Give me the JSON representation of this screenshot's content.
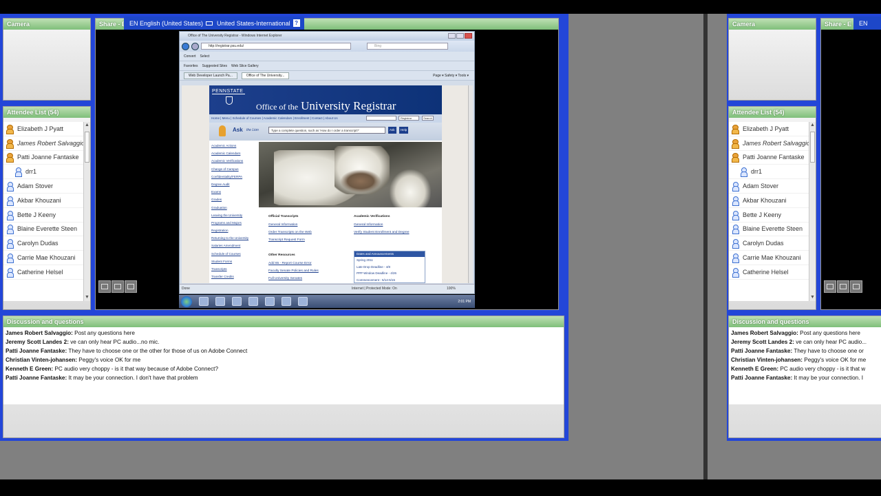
{
  "left_view": {
    "camera": {
      "title": "Camera"
    },
    "share": {
      "title": "Share - E"
    },
    "language_bar": {
      "input_language": "EN English (United States)",
      "keyboard_layout": "United States-International",
      "help_symbol": "?"
    },
    "attendees": {
      "title": "Attendee List (54)",
      "items": [
        {
          "name": "Elizabeth J Pyatt",
          "role": "host",
          "italic": false,
          "indent": false
        },
        {
          "name": "James Robert Salvaggio",
          "role": "host",
          "italic": true,
          "indent": false
        },
        {
          "name": "Patti Joanne Fantaske",
          "role": "host",
          "italic": false,
          "indent": false
        },
        {
          "name": "drr1",
          "role": "participant",
          "italic": false,
          "indent": true
        },
        {
          "name": "Adam Stover",
          "role": "participant",
          "italic": false,
          "indent": false
        },
        {
          "name": "Akbar Khouzani",
          "role": "participant",
          "italic": false,
          "indent": false
        },
        {
          "name": "Bette J Keeny",
          "role": "participant",
          "italic": false,
          "indent": false
        },
        {
          "name": "Blaine Everette Steen",
          "role": "participant",
          "italic": false,
          "indent": false
        },
        {
          "name": "Carolyn Dudas",
          "role": "participant",
          "italic": false,
          "indent": false
        },
        {
          "name": "Carrie Mae Khouzani",
          "role": "participant",
          "italic": false,
          "indent": false
        },
        {
          "name": "Catherine Helsel",
          "role": "participant",
          "italic": false,
          "indent": false
        }
      ]
    },
    "discussion": {
      "title": "Discussion and questions",
      "messages": [
        {
          "author": "James Robert Salvaggio:",
          "text": " Post any questions here"
        },
        {
          "author": "Jeremy Scott Landes 2:",
          "text": " ve can only hear PC audio...no mic."
        },
        {
          "author": "Patti Joanne Fantaske:",
          "text": " They have to choose one or the other for those of us on Adobe Connect"
        },
        {
          "author": "Christian Vinten-johansen:",
          "text": " Peggy's voice OK for me"
        },
        {
          "author": "Kenneth E Green:",
          "text": " PC audio very choppy - is it that way because of Adobe Connect?"
        },
        {
          "author": "Patti Joanne Fantaske:",
          "text": " It may be your connection. I don't have that problem"
        }
      ]
    },
    "add_button": "+"
  },
  "right_view": {
    "camera": {
      "title": "Camera"
    },
    "share": {
      "title": "Share - E"
    },
    "language_bar": {
      "input_language": "EN"
    },
    "attendees": {
      "title": "Attendee List (54)"
    },
    "discussion": {
      "title": "Discussion and questions",
      "messages": [
        {
          "author": "James Robert Salvaggio:",
          "text": " Post any questions here"
        },
        {
          "author": "Jeremy Scott Landes 2:",
          "text": " ve can only hear PC audio..."
        },
        {
          "author": "Patti Joanne Fantaske:",
          "text": " They have to choose one or"
        },
        {
          "author": "Christian Vinten-johansen:",
          "text": " Peggy's voice OK for me"
        },
        {
          "author": "Kenneth E Green:",
          "text": " PC audio very choppy - is it that w"
        },
        {
          "author": "Patti Joanne Fantaske:",
          "text": " It may be your connection. I"
        }
      ]
    },
    "add_button": "+"
  },
  "browser": {
    "title": "Office of The University Registrar - Windows Internet Explorer",
    "url": "http://registrar.psu.edu/",
    "search_placeholder": "Bing",
    "toolbar": [
      "Convert",
      "Select"
    ],
    "links": [
      "Favorites",
      "Suggested Sites",
      "Web Slice Gallery"
    ],
    "tabs": [
      {
        "label": "Web Developer Launch Pa...",
        "active": false
      },
      {
        "label": "Office of The University...",
        "active": true
      }
    ],
    "commands": "Page ▾   Safety ▾   Tools ▾",
    "status_left": "Done",
    "status_zone": "Internet | Protected Mode: On",
    "status_zoom": "100%",
    "site": {
      "wordmark": "PENNSTATE",
      "title_small": "Office of the",
      "title_large": "University Registrar",
      "nav": "Home | Menu | Schedule of Courses | Academic Calendars | Enrollment | Contact | About Us",
      "search_scope": "Registrar",
      "search_button": "Search",
      "ask": "Ask",
      "ask_sub": "the Lion",
      "ask_field": "Type a complete question, such as 'How do I order a transcript?'",
      "ask_button": "Ask",
      "ask_button2": "Help",
      "sidebar": [
        "Academic Actions",
        "Academic Calendars",
        "Academic Verifications",
        "Change of Campus",
        "Confidentiality/FERPA",
        "Degree Audit",
        "Exams",
        "Grades",
        "Graduation",
        "Leaving the University",
        "Programs and Majors",
        "Registration",
        "Returning to the University",
        "Salaries Amendment",
        "Schedule of Courses",
        "Student Forms",
        "Transcripts",
        "Transfer Credits"
      ],
      "col1_title": "Official Transcripts",
      "col1_links": [
        "General Information",
        "Order Transcripts on the Web",
        "Transcript Request Form"
      ],
      "col2_title": "Academic Verifications",
      "col2_links": [
        "General Information",
        "Verify Student Enrollment and Degree"
      ],
      "col3_title": "Other Resources",
      "col3_links": [
        "Add 65 - Report Course Error",
        "Faculty Senate Policies and Rules",
        "Full University Senates"
      ],
      "news_title": "Dates and Announcements",
      "news_items": [
        "Spring 2011",
        "Late Drop Deadline - 4/8",
        "PPP Window Deadline - 4/26",
        "Commencement - 5/14-5/15"
      ]
    },
    "taskbar_clock": "2:01 PM"
  },
  "colors": {
    "blue_frame": "#2346d8",
    "pod_title_green": "#7fbf7a",
    "psu_blue": "#1d3f8c"
  }
}
